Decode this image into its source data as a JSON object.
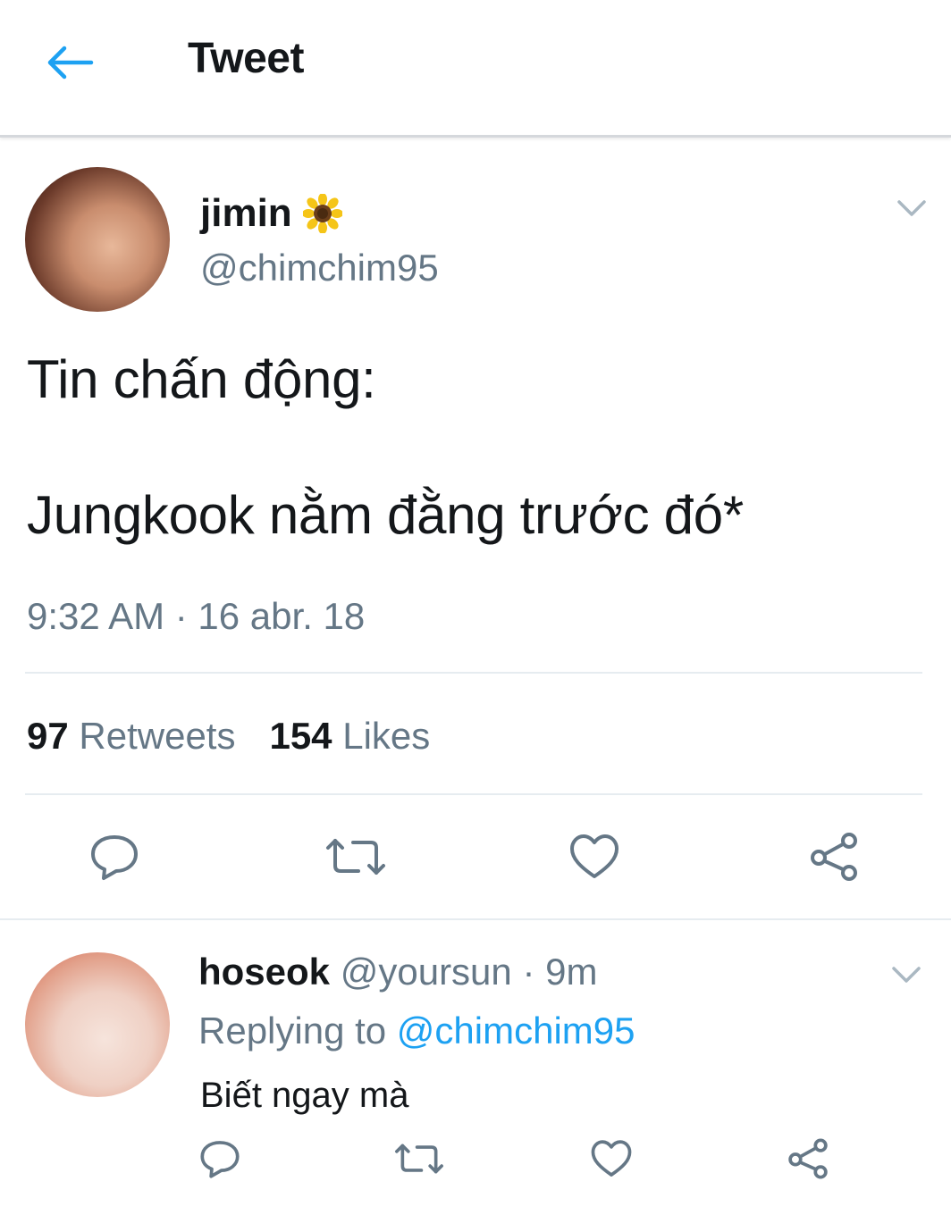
{
  "header": {
    "title": "Tweet",
    "back_icon": "arrow-left-icon"
  },
  "tweet": {
    "author_name": "jimin",
    "author_emoji": "sunflower-icon",
    "author_handle": "@chimchim95",
    "text_line1": "Tin chấn động:",
    "text_line2": "Jungkook nằm đằng trước đó*",
    "timestamp": "9:32 AM · 16 abr. 18",
    "retweets_count": "97",
    "retweets_label": "Retweets",
    "likes_count": "154",
    "likes_label": "Likes"
  },
  "reply": {
    "author_name": "hoseok",
    "author_handle": "@yoursun",
    "time": "· 9m",
    "replying_prefix": "Replying to",
    "replying_to": "@chimchim95",
    "text": "Biết ngay mà"
  },
  "colors": {
    "accent": "#1da1f2",
    "secondary_text": "#657786",
    "primary_text": "#14171a"
  },
  "icons": [
    "reply-icon",
    "retweet-icon",
    "like-icon",
    "share-icon",
    "chevron-down-icon"
  ]
}
